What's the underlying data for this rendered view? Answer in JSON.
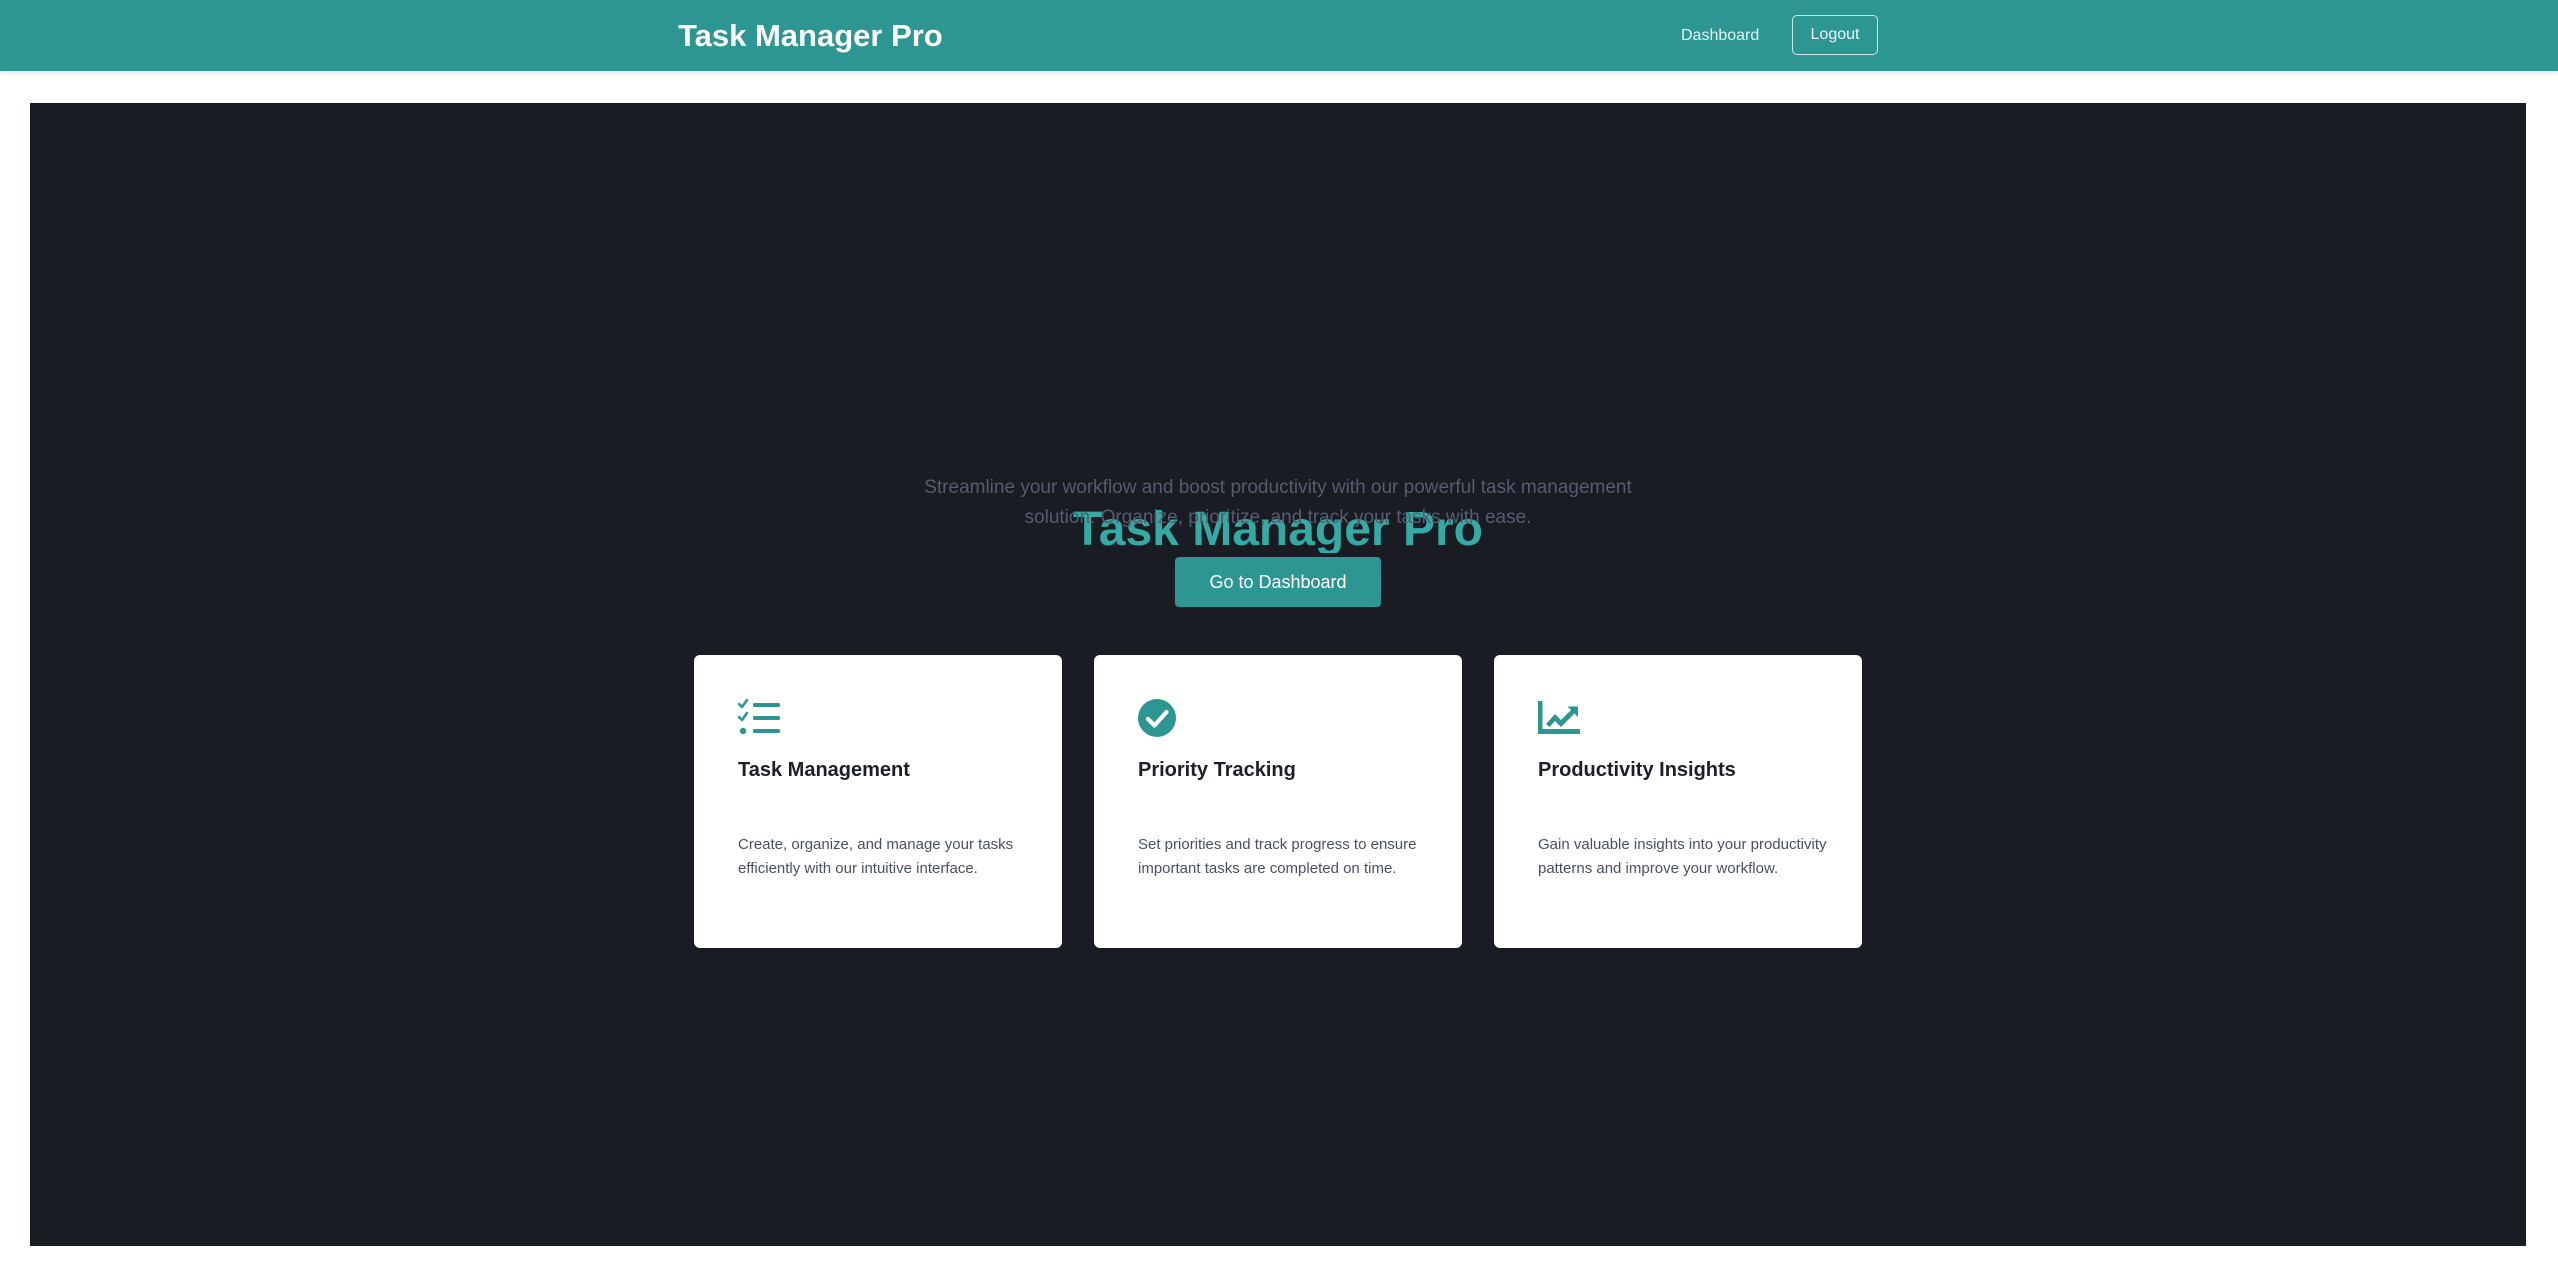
{
  "navbar": {
    "brand": "Task Manager Pro",
    "links": [
      {
        "label": "Dashboard"
      },
      {
        "label": "Logout"
      }
    ]
  },
  "hero": {
    "title": "Task Manager Pro",
    "subtitle": "Streamline your workflow and boost productivity with our powerful task management solution. Organize, prioritize, and track your tasks with ease.",
    "cta_label": "Go to Dashboard"
  },
  "features": [
    {
      "icon": "tasks-list-icon",
      "title": "Task Management",
      "description": "Create, organize, and manage your tasks efficiently with our intuitive interface."
    },
    {
      "icon": "check-circle-icon",
      "title": "Priority Tracking",
      "description": "Set priorities and track progress to ensure important tasks are completed on time."
    },
    {
      "icon": "chart-line-icon",
      "title": "Productivity Insights",
      "description": "Gain valuable insights into your productivity patterns and improve your workflow."
    }
  ],
  "colors": {
    "primary": "#2e9692",
    "hero_background": "#1a1c24",
    "hero_title": "#35aaa4",
    "card_background": "#ffffff"
  }
}
